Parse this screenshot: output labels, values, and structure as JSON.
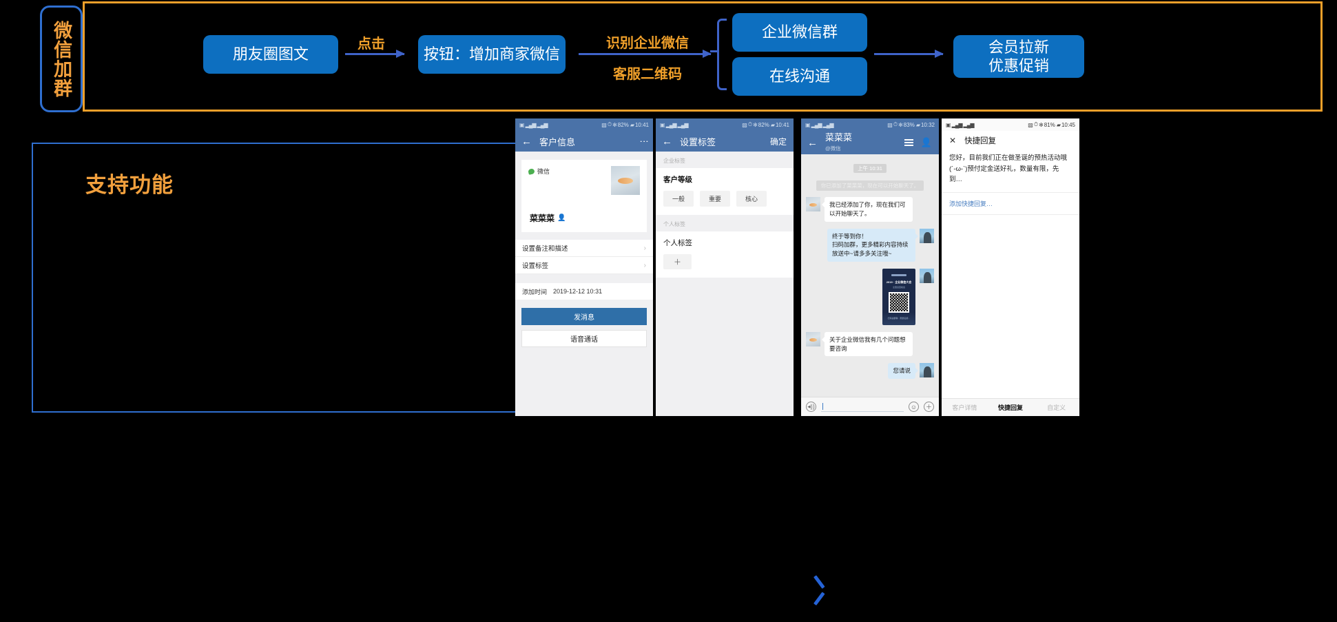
{
  "flow": {
    "badge_label": "微信加群",
    "boxes": [
      {
        "id": "moments",
        "label": "朋友圈图文"
      },
      {
        "id": "button-add-merchant",
        "label": "按钮：增加商家微信"
      },
      {
        "id": "work-wechat-group",
        "label": "企业微信群"
      },
      {
        "id": "online-chat",
        "label": "在线沟通"
      }
    ],
    "final_box": {
      "line1": "会员拉新",
      "line2": "优惠促销"
    },
    "labels": {
      "click": "点击",
      "recognize_line1": "识别企业微信",
      "recognize_line2": "客服二维码"
    },
    "colors": {
      "box_blue": "#0d6fc0",
      "accent_orange": "#f0a02a",
      "arrow_blue": "#3f63c9",
      "border_blue": "#2f6fd0"
    }
  },
  "support_panel": {
    "title": "支持功能"
  },
  "phone1": {
    "status": {
      "battery": "82%",
      "time": "10:41",
      "bluetooth": "✻"
    },
    "title": "客户信息",
    "back_icon": "←",
    "menu_icon": "⋮",
    "source_label": "微信",
    "contact_name": "菜菜菜",
    "rows": [
      {
        "label": "设置备注和描述",
        "chevron": "›"
      },
      {
        "label": "设置标签",
        "chevron": "›"
      }
    ],
    "added_time_label": "添加时间",
    "added_time_value": "2019-12-12 10:31",
    "primary_button": "发消息",
    "secondary_button": "语音通话"
  },
  "phone2": {
    "status": {
      "battery": "82%",
      "time": "10:41"
    },
    "title": "设置标签",
    "back_icon": "←",
    "confirm": "确定",
    "section_enterprise": "企业标签",
    "customer_level_label": "客户等级",
    "level_tags": [
      "一般",
      "重要",
      "核心"
    ],
    "section_personal": "个人标签",
    "personal_label": "个人标签",
    "add_tag": "＋"
  },
  "phone3": {
    "status": {
      "battery": "83%",
      "time": "10:32"
    },
    "title": "菜菜菜",
    "subtitle": "@微信",
    "back_icon": "←",
    "menu_icon": "menu-icon",
    "profile_icon": "person-icon",
    "chat_time": "上午 10:31",
    "system_message": "你已添加了菜菜菜，现在可以开始聊天了。",
    "messages": [
      {
        "side": "in",
        "text": "我已经添加了你，现在我们可以开始聊天了。"
      },
      {
        "side": "out",
        "text": "终于等到你！\n扫码加群，更多精彩内容持续放送中~请多多关注哦~"
      },
      {
        "side": "out",
        "type": "image",
        "card_title": "2019 · 企业微信大会",
        "card_sub": "全国巡回峰会",
        "card_foot": "扫码进群聊 · 限量名额…"
      },
      {
        "side": "in",
        "text": "关于企业微信我有几个问题想要咨询"
      },
      {
        "side": "out",
        "text": "您请说"
      }
    ],
    "input": {
      "voice_icon": "◂))",
      "emoji_icon": "☺",
      "plus_icon": "＋",
      "placeholder": ""
    }
  },
  "phone4": {
    "status": {
      "battery": "81%",
      "time": "10:45"
    },
    "close_icon": "✕",
    "title": "快捷回复",
    "message": "您好，目前我们正在做圣诞的预热活动哦(´-ω-`)预付定金送好礼，数量有限，先到…",
    "add_link": "添加快捷回复…",
    "tabs": [
      {
        "label": "客户详情",
        "active": false
      },
      {
        "label": "快捷回复",
        "active": true
      },
      {
        "label": "自定义",
        "active": false
      }
    ]
  },
  "bottom_nav": {
    "next_icon": "chevron-right-icon"
  }
}
